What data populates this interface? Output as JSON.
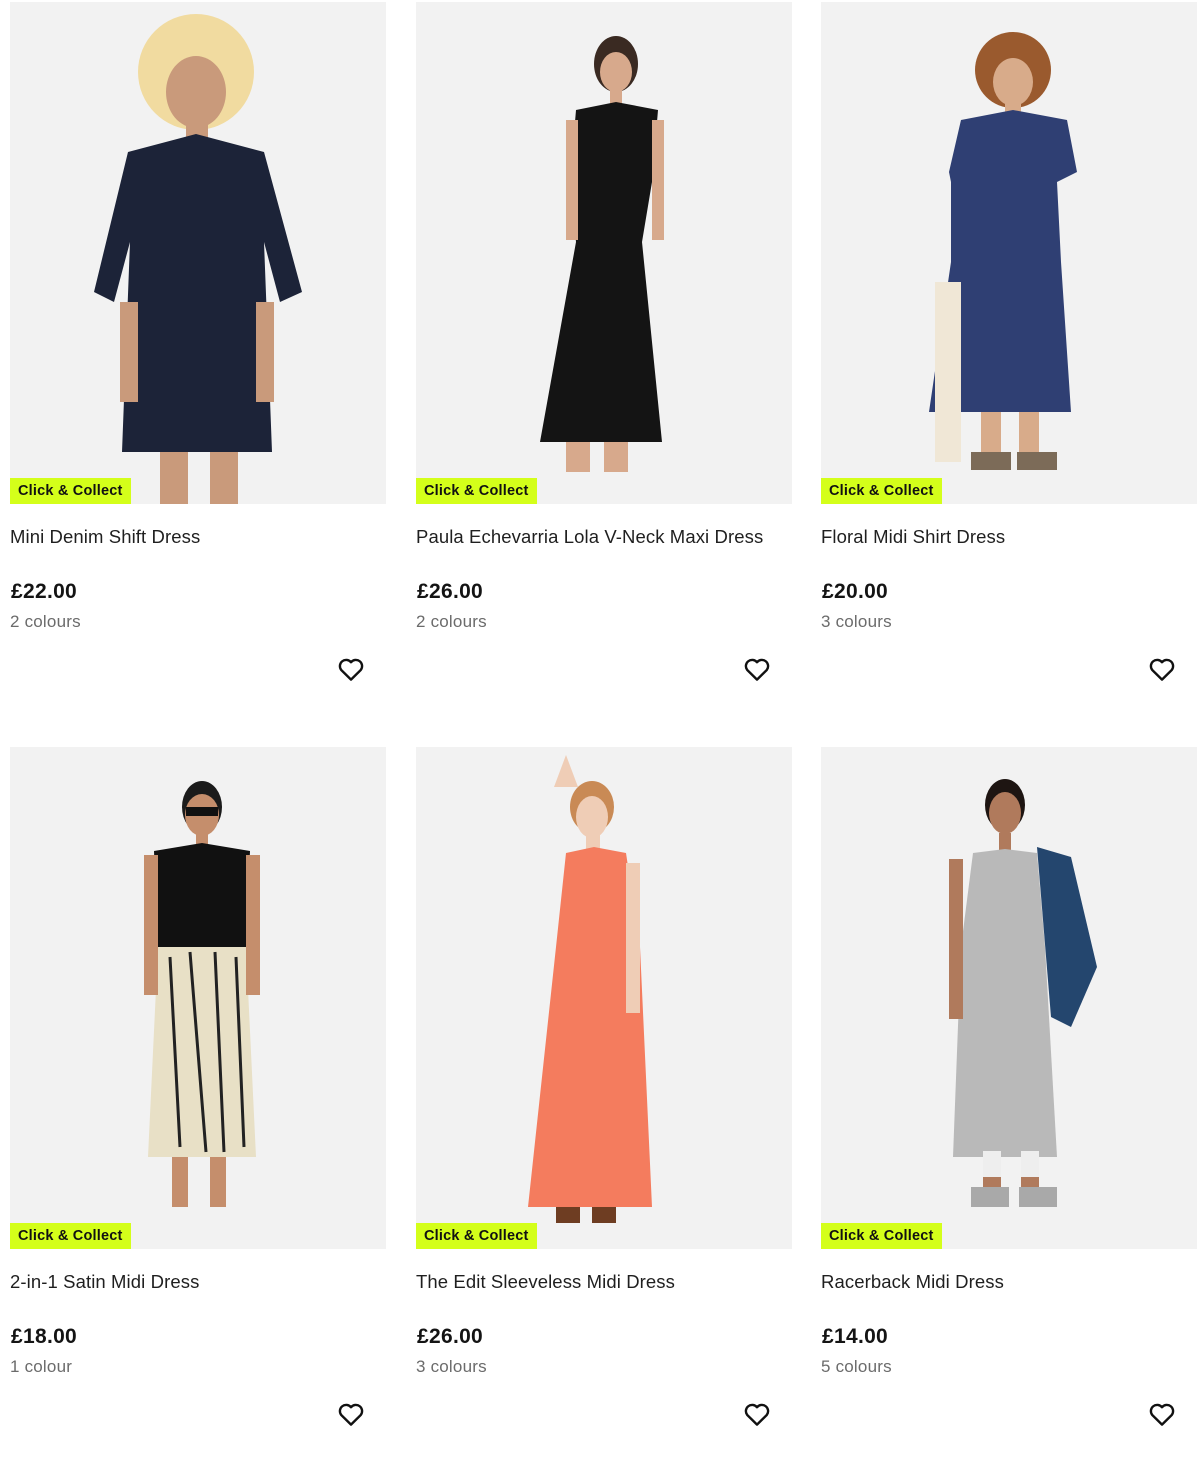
{
  "products": [
    {
      "name": "Mini Denim Shift Dress",
      "price": "£22.00",
      "colours": "2 colours",
      "badge": "Click & Collect",
      "image_icon": "model-denim-shift-dress",
      "dress_color": "#1c2338"
    },
    {
      "name": "Paula Echevarria Lola V-Neck Maxi Dress",
      "price": "£26.00",
      "colours": "2 colours",
      "badge": "Click & Collect",
      "image_icon": "model-black-maxi-dress",
      "dress_color": "#141414"
    },
    {
      "name": "Floral Midi Shirt Dress",
      "price": "£20.00",
      "colours": "3 colours",
      "badge": "Click & Collect",
      "image_icon": "model-floral-midi-dress",
      "dress_color": "#2f3f73"
    },
    {
      "name": "2-in-1 Satin Midi Dress",
      "price": "£18.00",
      "colours": "1 colour",
      "badge": "Click & Collect",
      "image_icon": "model-satin-midi-dress",
      "dress_color": "#e8e0c6"
    },
    {
      "name": "The Edit Sleeveless Midi Dress",
      "price": "£26.00",
      "colours": "3 colours",
      "badge": "Click & Collect",
      "image_icon": "model-coral-midi-dress",
      "dress_color": "#f47c5e"
    },
    {
      "name": "Racerback Midi Dress",
      "price": "£14.00",
      "colours": "5 colours",
      "badge": "Click & Collect",
      "image_icon": "model-grey-racerback-dress",
      "dress_color": "#b9b9b9"
    }
  ],
  "colors": {
    "badge_bg": "#d4ff1a",
    "image_bg": "#f2f2f2"
  },
  "wishlist_icon": "heart-outline-icon"
}
